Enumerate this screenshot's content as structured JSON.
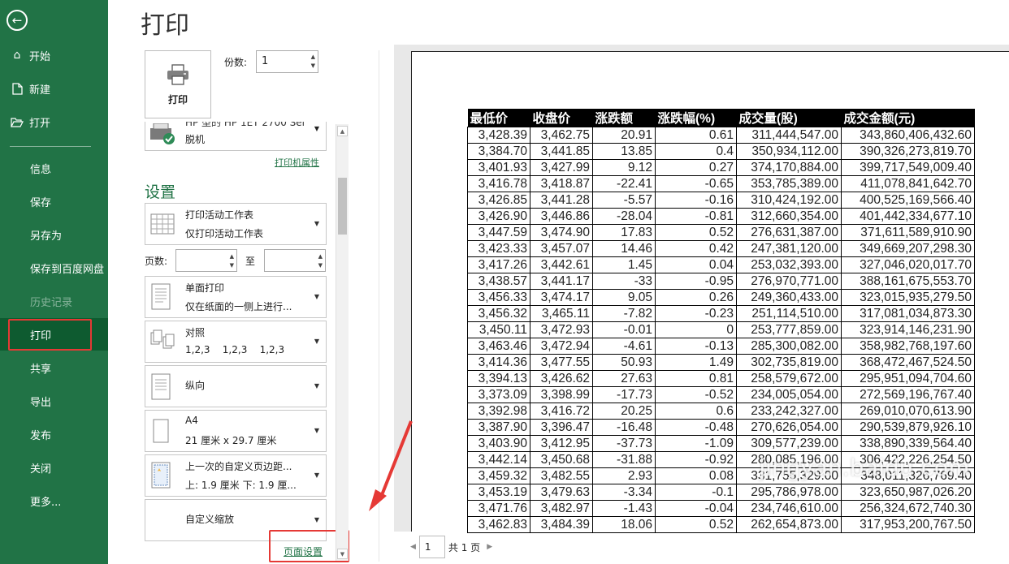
{
  "sidebar": {
    "items": [
      {
        "label": "开始",
        "icon": "home-icon"
      },
      {
        "label": "新建",
        "icon": "new-file-icon"
      },
      {
        "label": "打开",
        "icon": "folder-open-icon"
      },
      {
        "label": "信息"
      },
      {
        "label": "保存"
      },
      {
        "label": "另存为"
      },
      {
        "label": "保存到百度网盘"
      },
      {
        "label": "历史记录",
        "disabled": true
      },
      {
        "label": "打印",
        "active": true
      },
      {
        "label": "共享"
      },
      {
        "label": "导出"
      },
      {
        "label": "发布"
      },
      {
        "label": "关闭"
      },
      {
        "label": "更多..."
      }
    ]
  },
  "header": {
    "title": "打印"
  },
  "print": {
    "button_label": "打印",
    "copies_label": "份数:",
    "copies_value": "1"
  },
  "printer": {
    "name_partial": "HP 型的 HP 1ET 2700 Sel",
    "status": "脱机",
    "properties_link": "打印机属性"
  },
  "settings": {
    "heading": "设置",
    "sheets": {
      "line1": "打印活动工作表",
      "line2": "仅打印活动工作表"
    },
    "pages": {
      "label": "页数:",
      "to": "至"
    },
    "sides": {
      "line1": "单面打印",
      "line2": "仅在纸面的一侧上进行..."
    },
    "collate": {
      "line1": "对照",
      "line2": "1,2,3    1,2,3    1,2,3"
    },
    "orientation": {
      "line1": "纵向"
    },
    "paper": {
      "line1": "A4",
      "line2": "21 厘米 x 29.7 厘米"
    },
    "margins": {
      "line1": "上一次的自定义页边距...",
      "line2": "上: 1.9 厘米 下: 1.9 厘..."
    },
    "scaling": {
      "line1": "自定义缩放"
    },
    "page_setup_link": "页面设置"
  },
  "pager": {
    "current": "1",
    "total_text": "共 1 页"
  },
  "watermark": "jingyan.baidu.com",
  "table": {
    "headers": [
      "最低价",
      "收盘价",
      "涨跌额",
      "涨跌幅(%)",
      "成交量(股)",
      "成交金额(元)"
    ],
    "rows": [
      [
        "3,428.39",
        "3,462.75",
        "20.91",
        "0.61",
        "311,444,547.00",
        "343,860,406,432.60"
      ],
      [
        "3,384.70",
        "3,441.85",
        "13.85",
        "0.4",
        "350,934,112.00",
        "390,326,273,819.70"
      ],
      [
        "3,401.93",
        "3,427.99",
        "9.12",
        "0.27",
        "374,170,884.00",
        "399,717,549,009.40"
      ],
      [
        "3,416.78",
        "3,418.87",
        "-22.41",
        "-0.65",
        "353,785,389.00",
        "411,078,841,642.70"
      ],
      [
        "3,426.85",
        "3,441.28",
        "-5.57",
        "-0.16",
        "310,424,192.00",
        "400,525,169,566.40"
      ],
      [
        "3,426.90",
        "3,446.86",
        "-28.04",
        "-0.81",
        "312,660,354.00",
        "401,442,334,677.10"
      ],
      [
        "3,447.59",
        "3,474.90",
        "17.83",
        "0.52",
        "276,631,387.00",
        "371,611,589,910.90"
      ],
      [
        "3,423.33",
        "3,457.07",
        "14.46",
        "0.42",
        "247,381,120.00",
        "349,669,207,298.30"
      ],
      [
        "3,417.26",
        "3,442.61",
        "1.45",
        "0.04",
        "253,032,393.00",
        "327,046,020,017.70"
      ],
      [
        "3,438.57",
        "3,441.17",
        "-33",
        "-0.95",
        "276,970,771.00",
        "388,161,675,553.70"
      ],
      [
        "3,456.33",
        "3,474.17",
        "9.05",
        "0.26",
        "249,360,433.00",
        "323,015,935,279.50"
      ],
      [
        "3,456.32",
        "3,465.11",
        "-7.82",
        "-0.23",
        "251,114,510.00",
        "317,081,034,873.30"
      ],
      [
        "3,450.11",
        "3,472.93",
        "-0.01",
        "0",
        "253,777,859.00",
        "323,914,146,231.90"
      ],
      [
        "3,463.46",
        "3,472.94",
        "-4.61",
        "-0.13",
        "285,300,082.00",
        "358,982,768,197.60"
      ],
      [
        "3,414.36",
        "3,477.55",
        "50.93",
        "1.49",
        "302,735,819.00",
        "368,472,467,524.50"
      ],
      [
        "3,394.13",
        "3,426.62",
        "27.63",
        "0.81",
        "258,579,672.00",
        "295,951,094,704.60"
      ],
      [
        "3,373.09",
        "3,398.99",
        "-17.73",
        "-0.52",
        "234,005,054.00",
        "272,569,196,767.40"
      ],
      [
        "3,392.98",
        "3,416.72",
        "20.25",
        "0.6",
        "233,242,327.00",
        "269,010,070,613.90"
      ],
      [
        "3,387.90",
        "3,396.47",
        "-16.48",
        "-0.48",
        "270,626,054.00",
        "290,539,879,926.10"
      ],
      [
        "3,403.90",
        "3,412.95",
        "-37.73",
        "-1.09",
        "309,577,239.00",
        "338,890,339,564.40"
      ],
      [
        "3,442.14",
        "3,450.68",
        "-31.88",
        "-0.92",
        "280,085,196.00",
        "306,422,226,254.50"
      ],
      [
        "3,459.32",
        "3,482.55",
        "2.93",
        "0.08",
        "331,755,329.00",
        "348,011,326,769.40"
      ],
      [
        "3,453.19",
        "3,479.63",
        "-3.34",
        "-0.1",
        "295,786,978.00",
        "323,650,987,026.20"
      ],
      [
        "3,471.76",
        "3,482.97",
        "-1.43",
        "-0.04",
        "234,746,610.00",
        "256,324,672,740.30"
      ],
      [
        "3,462.83",
        "3,484.39",
        "18.06",
        "0.52",
        "262,654,873.00",
        "317,953,200,767.50"
      ]
    ]
  },
  "colors": {
    "sidebar_bg": "#217346",
    "sidebar_active": "#0e5b30",
    "accent": "#217346",
    "annotation_red": "#e53935"
  }
}
